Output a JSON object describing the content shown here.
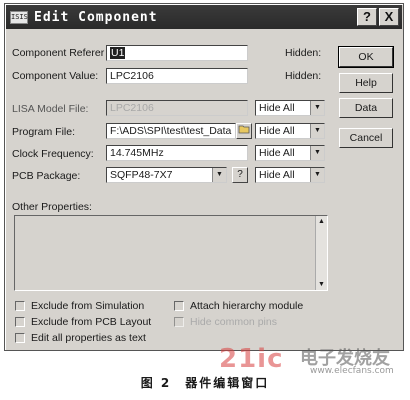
{
  "window": {
    "icon_text": "ISIS",
    "title": "Edit Component",
    "help_glyph": "?",
    "close_glyph": "X"
  },
  "fields": {
    "reference": {
      "label": "Component Referer",
      "value": "U1",
      "status": "Hidden:"
    },
    "value": {
      "label": "Component Value:",
      "value": "LPC2106",
      "status": "Hidden:"
    },
    "lisa": {
      "label": "LISA Model File:",
      "value": "LPC2106",
      "visibility": "Hide All"
    },
    "program": {
      "label": "Program File:",
      "value": "F:\\ADS\\SPI\\test\\test_Data",
      "visibility": "Hide All"
    },
    "clock": {
      "label": "Clock Frequency:",
      "value": "14.745MHz",
      "visibility": "Hide All"
    },
    "pcb": {
      "label": "PCB Package:",
      "value": "SQFP48-7X7",
      "query": "?",
      "visibility": "Hide All"
    }
  },
  "other_properties_label": "Other Properties:",
  "buttons": {
    "ok": "OK",
    "help": "Help",
    "data": "Data",
    "cancel": "Cancel"
  },
  "checkboxes": {
    "exclude_sim": "Exclude from Simulation",
    "exclude_pcb": "Exclude from PCB Layout",
    "edit_all": "Edit all properties as text",
    "attach_hier": "Attach hierarchy module",
    "hide_pins": "Hide common pins"
  },
  "caption": "图 2　器件编辑窗口",
  "watermark": {
    "big": "21ic",
    "site": "电子发烧友",
    "url": "www.elecfans.com"
  }
}
